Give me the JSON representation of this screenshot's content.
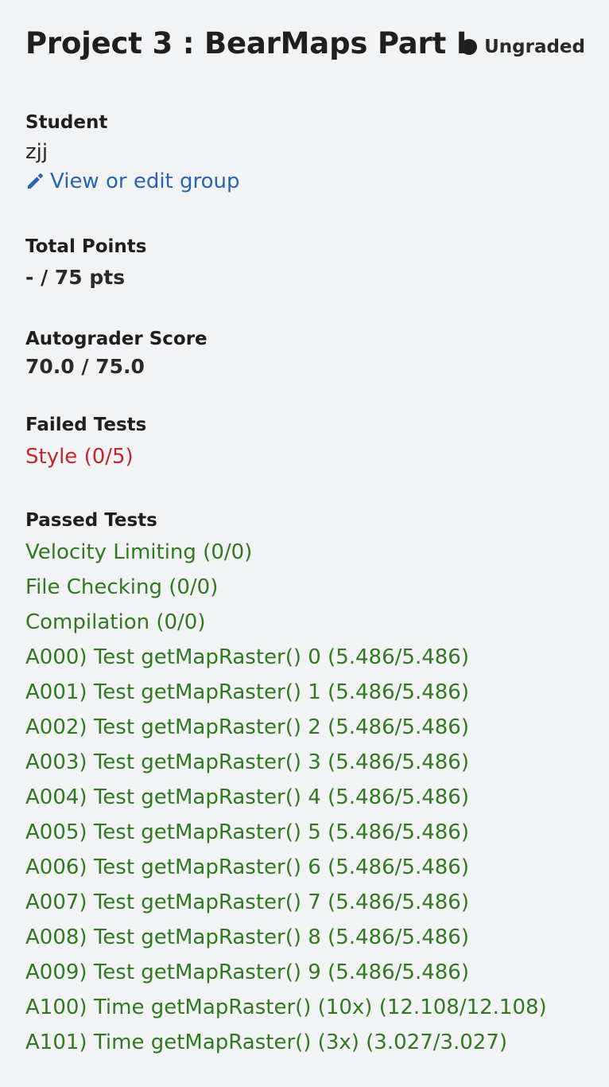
{
  "header": {
    "title": "Project 3 : BearMaps Part I",
    "status": "Ungraded"
  },
  "student": {
    "label": "Student",
    "name": "zjj",
    "edit_link": "View or edit group"
  },
  "total_points": {
    "label": "Total Points",
    "value": "- / 75 pts"
  },
  "autograder": {
    "label": "Autograder Score",
    "value": "70.0 / 75.0"
  },
  "failed_tests": {
    "label": "Failed Tests",
    "items": [
      "Style (0/5)"
    ]
  },
  "passed_tests": {
    "label": "Passed Tests",
    "items": [
      "Velocity Limiting (0/0)",
      "File Checking (0/0)",
      "Compilation (0/0)",
      "A000) Test getMapRaster() 0 (5.486/5.486)",
      "A001) Test getMapRaster() 1 (5.486/5.486)",
      "A002) Test getMapRaster() 2 (5.486/5.486)",
      "A003) Test getMapRaster() 3 (5.486/5.486)",
      "A004) Test getMapRaster() 4 (5.486/5.486)",
      "A005) Test getMapRaster() 5 (5.486/5.486)",
      "A006) Test getMapRaster() 6 (5.486/5.486)",
      "A007) Test getMapRaster() 7 (5.486/5.486)",
      "A008) Test getMapRaster() 8 (5.486/5.486)",
      "A009) Test getMapRaster() 9 (5.486/5.486)",
      "A100) Time getMapRaster() (10x) (12.108/12.108)",
      "A101) Time getMapRaster() (3x) (3.027/3.027)"
    ]
  },
  "colors": {
    "background": "#f2f3f5",
    "link": "#2a64b0",
    "failed": "#c0272f",
    "passed": "#2f7a1f",
    "status_dot": "#1f1f1f"
  },
  "icons": {
    "status": "status-dot-icon",
    "edit": "pencil-icon"
  }
}
